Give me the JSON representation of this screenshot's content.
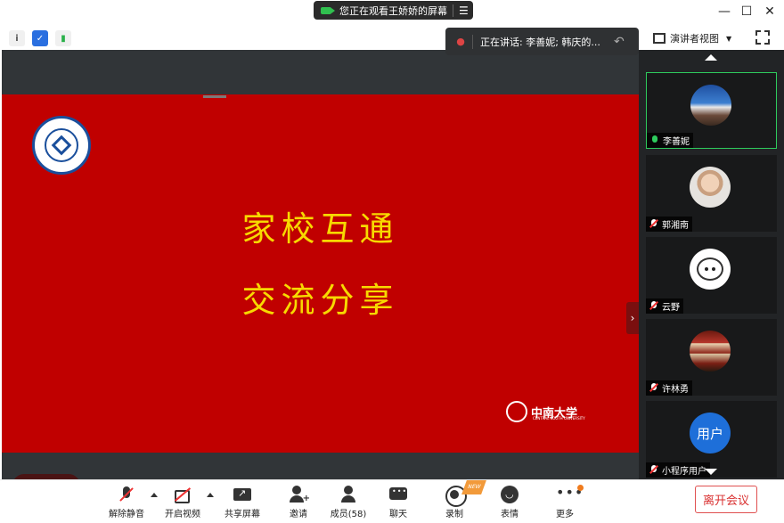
{
  "titlebar": {
    "share_notice": "您正在观看王娇娇的屏幕",
    "menu_icon": "menu-icon",
    "window_controls": [
      "minimize-icon",
      "maximize-icon",
      "close-icon"
    ]
  },
  "header": {
    "info_icons": [
      "info-icon",
      "shield-icon",
      "signal-icon"
    ],
    "speaking_label": "正在讲话: 李善妮; 韩庆的...",
    "view_mode": "演讲者视图"
  },
  "slide": {
    "line1": "家校互通",
    "line2": "交流分享",
    "brand_name": "中南大学",
    "brand_sub": "CENTRAL SOUTH UNIVERSITY"
  },
  "gallery": {
    "participants": [
      {
        "name": "李善妮",
        "avatar": "mountain",
        "speaking": true
      },
      {
        "name": "郭湘南",
        "avatar": "photo",
        "speaking": false
      },
      {
        "name": "云野",
        "avatar": "cat",
        "speaking": false
      },
      {
        "name": "许林勇",
        "avatar": "books",
        "speaking": false
      },
      {
        "name": "小程序用户",
        "avatar": "用户",
        "speaking": false
      }
    ]
  },
  "toolbar": {
    "unmute": "解除静音",
    "start_video": "开启视频",
    "share_screen": "共享屏幕",
    "invite": "邀请",
    "members": "成员(58)",
    "chat": "聊天",
    "record": "录制",
    "reactions": "表情",
    "more": "更多",
    "leave": "离开会议",
    "record_badge": "NEW"
  },
  "colors": {
    "slide_bg": "#c00000",
    "slide_text": "#f7d900",
    "leave": "#d93030",
    "speaking": "#2ecb5d"
  }
}
